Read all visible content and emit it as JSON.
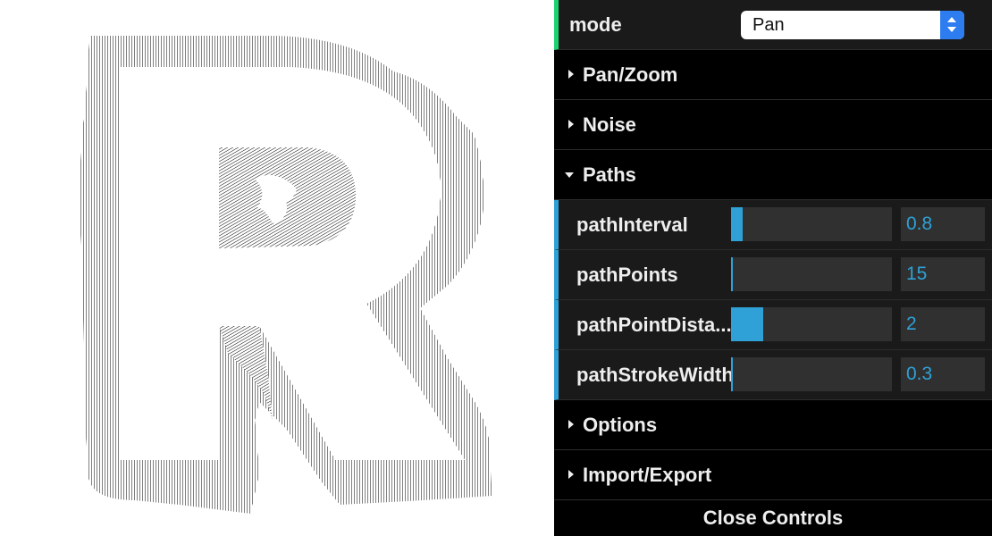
{
  "canvas": {
    "description_icon": "letter-r-line-art"
  },
  "controls": {
    "mode": {
      "label": "mode",
      "value": "Pan"
    },
    "folders": [
      {
        "label": "Pan/Zoom",
        "open": false
      },
      {
        "label": "Noise",
        "open": false
      },
      {
        "label": "Paths",
        "open": true
      },
      {
        "label": "Options",
        "open": false
      },
      {
        "label": "Import/Export",
        "open": false
      }
    ],
    "paths": [
      {
        "label": "pathInterval",
        "value": "0.8",
        "fill_fraction": 0.07
      },
      {
        "label": "pathPoints",
        "value": "15",
        "fill_fraction": 0.01
      },
      {
        "label": "pathPointDista...",
        "value": "2",
        "fill_fraction": 0.2
      },
      {
        "label": "pathStrokeWidth",
        "value": "0.3",
        "fill_fraction": 0.01
      }
    ],
    "close_label": "Close Controls"
  },
  "colors": {
    "accent": "#2fa1d6",
    "mode_accent": "#1ed36f",
    "panel_bg": "#000000",
    "row_bg": "#1a1a1a"
  }
}
